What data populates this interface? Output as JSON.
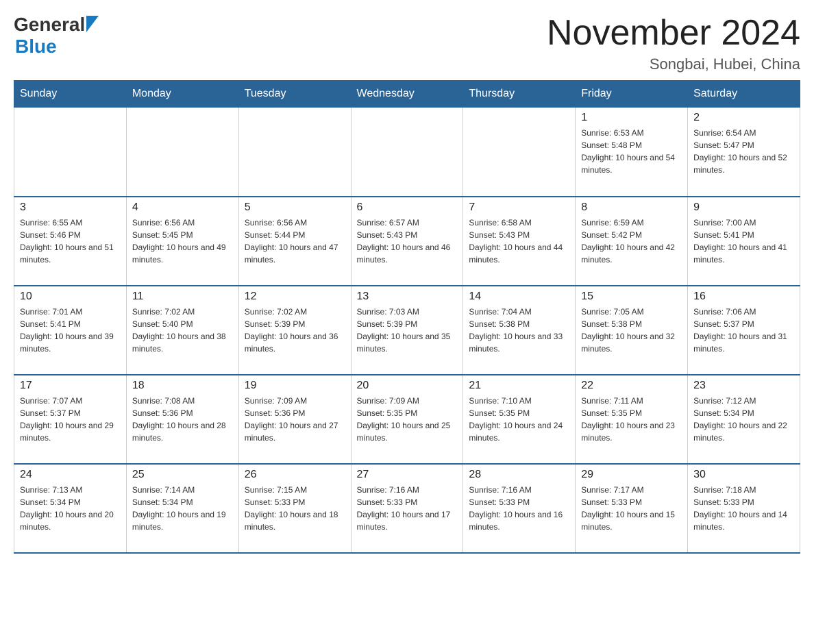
{
  "header": {
    "logo_general": "General",
    "logo_blue": "Blue",
    "month_title": "November 2024",
    "location": "Songbai, Hubei, China"
  },
  "days_of_week": [
    "Sunday",
    "Monday",
    "Tuesday",
    "Wednesday",
    "Thursday",
    "Friday",
    "Saturday"
  ],
  "weeks": [
    [
      {
        "day": "",
        "sunrise": "",
        "sunset": "",
        "daylight": ""
      },
      {
        "day": "",
        "sunrise": "",
        "sunset": "",
        "daylight": ""
      },
      {
        "day": "",
        "sunrise": "",
        "sunset": "",
        "daylight": ""
      },
      {
        "day": "",
        "sunrise": "",
        "sunset": "",
        "daylight": ""
      },
      {
        "day": "",
        "sunrise": "",
        "sunset": "",
        "daylight": ""
      },
      {
        "day": "1",
        "sunrise": "Sunrise: 6:53 AM",
        "sunset": "Sunset: 5:48 PM",
        "daylight": "Daylight: 10 hours and 54 minutes."
      },
      {
        "day": "2",
        "sunrise": "Sunrise: 6:54 AM",
        "sunset": "Sunset: 5:47 PM",
        "daylight": "Daylight: 10 hours and 52 minutes."
      }
    ],
    [
      {
        "day": "3",
        "sunrise": "Sunrise: 6:55 AM",
        "sunset": "Sunset: 5:46 PM",
        "daylight": "Daylight: 10 hours and 51 minutes."
      },
      {
        "day": "4",
        "sunrise": "Sunrise: 6:56 AM",
        "sunset": "Sunset: 5:45 PM",
        "daylight": "Daylight: 10 hours and 49 minutes."
      },
      {
        "day": "5",
        "sunrise": "Sunrise: 6:56 AM",
        "sunset": "Sunset: 5:44 PM",
        "daylight": "Daylight: 10 hours and 47 minutes."
      },
      {
        "day": "6",
        "sunrise": "Sunrise: 6:57 AM",
        "sunset": "Sunset: 5:43 PM",
        "daylight": "Daylight: 10 hours and 46 minutes."
      },
      {
        "day": "7",
        "sunrise": "Sunrise: 6:58 AM",
        "sunset": "Sunset: 5:43 PM",
        "daylight": "Daylight: 10 hours and 44 minutes."
      },
      {
        "day": "8",
        "sunrise": "Sunrise: 6:59 AM",
        "sunset": "Sunset: 5:42 PM",
        "daylight": "Daylight: 10 hours and 42 minutes."
      },
      {
        "day": "9",
        "sunrise": "Sunrise: 7:00 AM",
        "sunset": "Sunset: 5:41 PM",
        "daylight": "Daylight: 10 hours and 41 minutes."
      }
    ],
    [
      {
        "day": "10",
        "sunrise": "Sunrise: 7:01 AM",
        "sunset": "Sunset: 5:41 PM",
        "daylight": "Daylight: 10 hours and 39 minutes."
      },
      {
        "day": "11",
        "sunrise": "Sunrise: 7:02 AM",
        "sunset": "Sunset: 5:40 PM",
        "daylight": "Daylight: 10 hours and 38 minutes."
      },
      {
        "day": "12",
        "sunrise": "Sunrise: 7:02 AM",
        "sunset": "Sunset: 5:39 PM",
        "daylight": "Daylight: 10 hours and 36 minutes."
      },
      {
        "day": "13",
        "sunrise": "Sunrise: 7:03 AM",
        "sunset": "Sunset: 5:39 PM",
        "daylight": "Daylight: 10 hours and 35 minutes."
      },
      {
        "day": "14",
        "sunrise": "Sunrise: 7:04 AM",
        "sunset": "Sunset: 5:38 PM",
        "daylight": "Daylight: 10 hours and 33 minutes."
      },
      {
        "day": "15",
        "sunrise": "Sunrise: 7:05 AM",
        "sunset": "Sunset: 5:38 PM",
        "daylight": "Daylight: 10 hours and 32 minutes."
      },
      {
        "day": "16",
        "sunrise": "Sunrise: 7:06 AM",
        "sunset": "Sunset: 5:37 PM",
        "daylight": "Daylight: 10 hours and 31 minutes."
      }
    ],
    [
      {
        "day": "17",
        "sunrise": "Sunrise: 7:07 AM",
        "sunset": "Sunset: 5:37 PM",
        "daylight": "Daylight: 10 hours and 29 minutes."
      },
      {
        "day": "18",
        "sunrise": "Sunrise: 7:08 AM",
        "sunset": "Sunset: 5:36 PM",
        "daylight": "Daylight: 10 hours and 28 minutes."
      },
      {
        "day": "19",
        "sunrise": "Sunrise: 7:09 AM",
        "sunset": "Sunset: 5:36 PM",
        "daylight": "Daylight: 10 hours and 27 minutes."
      },
      {
        "day": "20",
        "sunrise": "Sunrise: 7:09 AM",
        "sunset": "Sunset: 5:35 PM",
        "daylight": "Daylight: 10 hours and 25 minutes."
      },
      {
        "day": "21",
        "sunrise": "Sunrise: 7:10 AM",
        "sunset": "Sunset: 5:35 PM",
        "daylight": "Daylight: 10 hours and 24 minutes."
      },
      {
        "day": "22",
        "sunrise": "Sunrise: 7:11 AM",
        "sunset": "Sunset: 5:35 PM",
        "daylight": "Daylight: 10 hours and 23 minutes."
      },
      {
        "day": "23",
        "sunrise": "Sunrise: 7:12 AM",
        "sunset": "Sunset: 5:34 PM",
        "daylight": "Daylight: 10 hours and 22 minutes."
      }
    ],
    [
      {
        "day": "24",
        "sunrise": "Sunrise: 7:13 AM",
        "sunset": "Sunset: 5:34 PM",
        "daylight": "Daylight: 10 hours and 20 minutes."
      },
      {
        "day": "25",
        "sunrise": "Sunrise: 7:14 AM",
        "sunset": "Sunset: 5:34 PM",
        "daylight": "Daylight: 10 hours and 19 minutes."
      },
      {
        "day": "26",
        "sunrise": "Sunrise: 7:15 AM",
        "sunset": "Sunset: 5:33 PM",
        "daylight": "Daylight: 10 hours and 18 minutes."
      },
      {
        "day": "27",
        "sunrise": "Sunrise: 7:16 AM",
        "sunset": "Sunset: 5:33 PM",
        "daylight": "Daylight: 10 hours and 17 minutes."
      },
      {
        "day": "28",
        "sunrise": "Sunrise: 7:16 AM",
        "sunset": "Sunset: 5:33 PM",
        "daylight": "Daylight: 10 hours and 16 minutes."
      },
      {
        "day": "29",
        "sunrise": "Sunrise: 7:17 AM",
        "sunset": "Sunset: 5:33 PM",
        "daylight": "Daylight: 10 hours and 15 minutes."
      },
      {
        "day": "30",
        "sunrise": "Sunrise: 7:18 AM",
        "sunset": "Sunset: 5:33 PM",
        "daylight": "Daylight: 10 hours and 14 minutes."
      }
    ]
  ]
}
